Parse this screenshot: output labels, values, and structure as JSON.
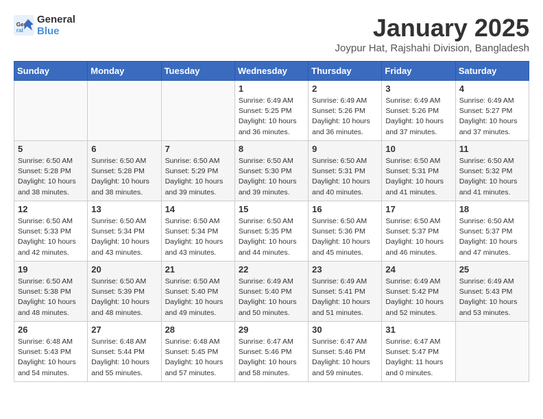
{
  "header": {
    "logo_line1": "General",
    "logo_line2": "Blue",
    "title": "January 2025",
    "subtitle": "Joypur Hat, Rajshahi Division, Bangladesh"
  },
  "days_of_week": [
    "Sunday",
    "Monday",
    "Tuesday",
    "Wednesday",
    "Thursday",
    "Friday",
    "Saturday"
  ],
  "weeks": [
    [
      {
        "day": "",
        "info": ""
      },
      {
        "day": "",
        "info": ""
      },
      {
        "day": "",
        "info": ""
      },
      {
        "day": "1",
        "info": "Sunrise: 6:49 AM\nSunset: 5:25 PM\nDaylight: 10 hours\nand 36 minutes."
      },
      {
        "day": "2",
        "info": "Sunrise: 6:49 AM\nSunset: 5:26 PM\nDaylight: 10 hours\nand 36 minutes."
      },
      {
        "day": "3",
        "info": "Sunrise: 6:49 AM\nSunset: 5:26 PM\nDaylight: 10 hours\nand 37 minutes."
      },
      {
        "day": "4",
        "info": "Sunrise: 6:49 AM\nSunset: 5:27 PM\nDaylight: 10 hours\nand 37 minutes."
      }
    ],
    [
      {
        "day": "5",
        "info": "Sunrise: 6:50 AM\nSunset: 5:28 PM\nDaylight: 10 hours\nand 38 minutes."
      },
      {
        "day": "6",
        "info": "Sunrise: 6:50 AM\nSunset: 5:28 PM\nDaylight: 10 hours\nand 38 minutes."
      },
      {
        "day": "7",
        "info": "Sunrise: 6:50 AM\nSunset: 5:29 PM\nDaylight: 10 hours\nand 39 minutes."
      },
      {
        "day": "8",
        "info": "Sunrise: 6:50 AM\nSunset: 5:30 PM\nDaylight: 10 hours\nand 39 minutes."
      },
      {
        "day": "9",
        "info": "Sunrise: 6:50 AM\nSunset: 5:31 PM\nDaylight: 10 hours\nand 40 minutes."
      },
      {
        "day": "10",
        "info": "Sunrise: 6:50 AM\nSunset: 5:31 PM\nDaylight: 10 hours\nand 41 minutes."
      },
      {
        "day": "11",
        "info": "Sunrise: 6:50 AM\nSunset: 5:32 PM\nDaylight: 10 hours\nand 41 minutes."
      }
    ],
    [
      {
        "day": "12",
        "info": "Sunrise: 6:50 AM\nSunset: 5:33 PM\nDaylight: 10 hours\nand 42 minutes."
      },
      {
        "day": "13",
        "info": "Sunrise: 6:50 AM\nSunset: 5:34 PM\nDaylight: 10 hours\nand 43 minutes."
      },
      {
        "day": "14",
        "info": "Sunrise: 6:50 AM\nSunset: 5:34 PM\nDaylight: 10 hours\nand 43 minutes."
      },
      {
        "day": "15",
        "info": "Sunrise: 6:50 AM\nSunset: 5:35 PM\nDaylight: 10 hours\nand 44 minutes."
      },
      {
        "day": "16",
        "info": "Sunrise: 6:50 AM\nSunset: 5:36 PM\nDaylight: 10 hours\nand 45 minutes."
      },
      {
        "day": "17",
        "info": "Sunrise: 6:50 AM\nSunset: 5:37 PM\nDaylight: 10 hours\nand 46 minutes."
      },
      {
        "day": "18",
        "info": "Sunrise: 6:50 AM\nSunset: 5:37 PM\nDaylight: 10 hours\nand 47 minutes."
      }
    ],
    [
      {
        "day": "19",
        "info": "Sunrise: 6:50 AM\nSunset: 5:38 PM\nDaylight: 10 hours\nand 48 minutes."
      },
      {
        "day": "20",
        "info": "Sunrise: 6:50 AM\nSunset: 5:39 PM\nDaylight: 10 hours\nand 48 minutes."
      },
      {
        "day": "21",
        "info": "Sunrise: 6:50 AM\nSunset: 5:40 PM\nDaylight: 10 hours\nand 49 minutes."
      },
      {
        "day": "22",
        "info": "Sunrise: 6:49 AM\nSunset: 5:40 PM\nDaylight: 10 hours\nand 50 minutes."
      },
      {
        "day": "23",
        "info": "Sunrise: 6:49 AM\nSunset: 5:41 PM\nDaylight: 10 hours\nand 51 minutes."
      },
      {
        "day": "24",
        "info": "Sunrise: 6:49 AM\nSunset: 5:42 PM\nDaylight: 10 hours\nand 52 minutes."
      },
      {
        "day": "25",
        "info": "Sunrise: 6:49 AM\nSunset: 5:43 PM\nDaylight: 10 hours\nand 53 minutes."
      }
    ],
    [
      {
        "day": "26",
        "info": "Sunrise: 6:48 AM\nSunset: 5:43 PM\nDaylight: 10 hours\nand 54 minutes."
      },
      {
        "day": "27",
        "info": "Sunrise: 6:48 AM\nSunset: 5:44 PM\nDaylight: 10 hours\nand 55 minutes."
      },
      {
        "day": "28",
        "info": "Sunrise: 6:48 AM\nSunset: 5:45 PM\nDaylight: 10 hours\nand 57 minutes."
      },
      {
        "day": "29",
        "info": "Sunrise: 6:47 AM\nSunset: 5:46 PM\nDaylight: 10 hours\nand 58 minutes."
      },
      {
        "day": "30",
        "info": "Sunrise: 6:47 AM\nSunset: 5:46 PM\nDaylight: 10 hours\nand 59 minutes."
      },
      {
        "day": "31",
        "info": "Sunrise: 6:47 AM\nSunset: 5:47 PM\nDaylight: 11 hours\nand 0 minutes."
      },
      {
        "day": "",
        "info": ""
      }
    ]
  ]
}
